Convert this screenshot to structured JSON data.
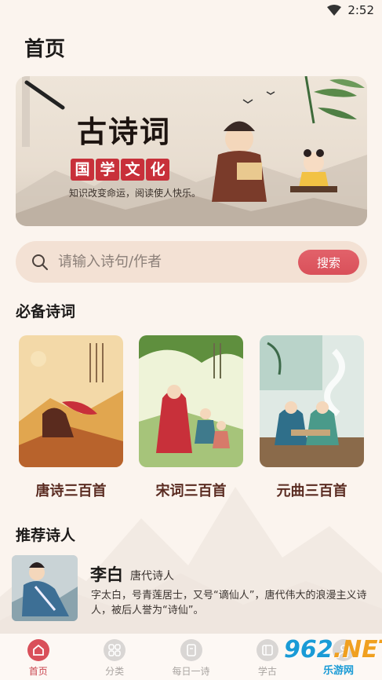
{
  "status": {
    "time": "2:52"
  },
  "header": {
    "title": "首页"
  },
  "banner": {
    "title": "古诗词",
    "seal": [
      "国",
      "学",
      "文",
      "化"
    ],
    "slogan": "知识改变命运，阅读使人快乐。"
  },
  "search": {
    "placeholder": "请输入诗句/作者",
    "button_label": "搜索"
  },
  "essential": {
    "section_title": "必备诗词",
    "items": [
      {
        "label": "唐诗三百首"
      },
      {
        "label": "宋词三百首"
      },
      {
        "label": "元曲三百首"
      }
    ]
  },
  "poets": {
    "section_title": "推荐诗人",
    "items": [
      {
        "name": "李白",
        "era": "唐代诗人",
        "desc": "字太白，号青莲居士，又号“谪仙人”，唐代伟大的浪漫主义诗人，被后人誉为“诗仙”。"
      }
    ]
  },
  "tabs": [
    {
      "label": "首页",
      "icon": "home-icon",
      "active": true
    },
    {
      "label": "分类",
      "icon": "grid-icon",
      "active": false
    },
    {
      "label": "每日一诗",
      "icon": "book-icon",
      "active": false
    },
    {
      "label": "学古",
      "icon": "study-icon",
      "active": false
    },
    {
      "label": "",
      "icon": "user-icon",
      "active": false
    }
  ],
  "watermark": {
    "number": "962",
    "suffix": ".NET",
    "text": "乐游网"
  },
  "colors": {
    "accent": "#d9505a",
    "background": "#fbf4ee",
    "search_bg": "#f3e1d4",
    "card_label": "#5a2b21"
  }
}
